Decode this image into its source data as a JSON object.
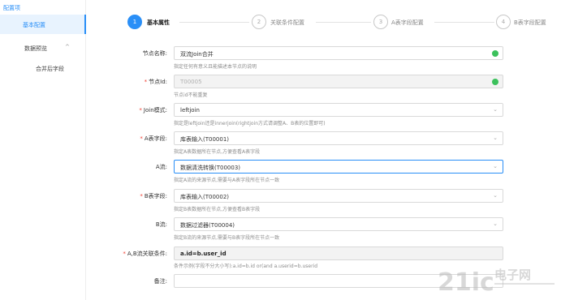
{
  "sidebar": {
    "title": "配置项",
    "active_item": "基本配置",
    "group_label": "数据预览",
    "group_chevron": "^",
    "sub_item": "合并后字段"
  },
  "steps": [
    {
      "num": "1",
      "label": "基本属性",
      "state": "active"
    },
    {
      "num": "2",
      "label": "关联条件配置",
      "state": "idle"
    },
    {
      "num": "3",
      "label": "A表字段配置",
      "state": "idle"
    },
    {
      "num": "4",
      "label": "B表字段配置",
      "state": "idle"
    }
  ],
  "form": {
    "node_name": {
      "label": "节点名称:",
      "value": "双流Join合并",
      "hint": "指定任何有意义且能描述本节点的说明",
      "status_color": "#3cc15c"
    },
    "node_id": {
      "label": "节点Id:",
      "value": "T00005",
      "hint": "节点id不能重复",
      "status_color": "#3cc15c"
    },
    "join_mode": {
      "label": "Join模式:",
      "value": "leftjoin",
      "hint": "指定是leftjoin还是innerjoin(rightjoin方式请调整A、B表的位置即可)"
    },
    "a_table": {
      "label": "A表字段:",
      "value": "库表输入(T00001)",
      "hint": "指定A表数据所在节点,方便查看A表字段"
    },
    "a_stream": {
      "label": "A流:",
      "value": "数据清洗转换(T00003)",
      "hint": "指定A流的来源节点,需要与A表字段所在节点一致"
    },
    "b_table": {
      "label": "B表字段:",
      "value": "库表输入(T00002)",
      "hint": "指定B表数据所在节点,方便查看B表字段"
    },
    "b_stream": {
      "label": "B流:",
      "value": "数据过滤器(T00004)",
      "hint": "指定B流的来源节点,需要与B表字段所在节点一致"
    },
    "join_condition": {
      "label": "A,B流关联条件:",
      "value": "a.id=b.user_id",
      "hint": "条件示例(字段不分大小写):a.id=b.id or(and a.userid=b.userid"
    },
    "remark": {
      "label": "备注:",
      "value": ""
    }
  },
  "required_mark": "*",
  "watermark": "21ic 电子网",
  "accent_color": "#2a8ff7"
}
